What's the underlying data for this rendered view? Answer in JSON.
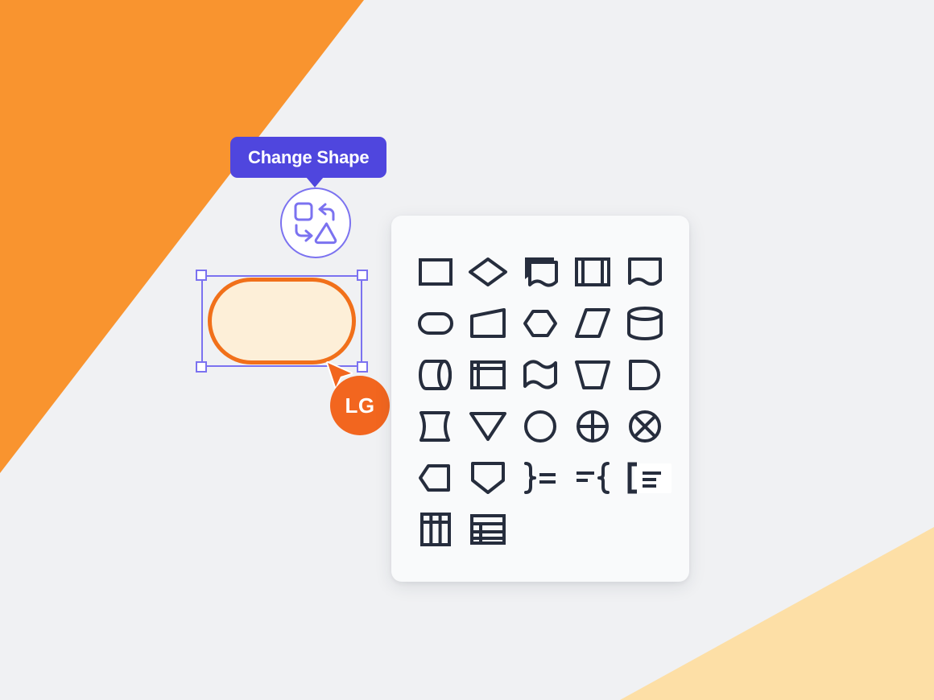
{
  "canvas": {
    "background_color": "#F0F1F3",
    "wedge_top_left_color": "#F9942F",
    "wedge_bottom_right_color": "#FDDFA6"
  },
  "tooltip": {
    "label": "Change Shape",
    "background_color": "#4F46DE",
    "text_color": "#FFFFFF"
  },
  "change_shape_button": {
    "icon": "change-shape-icon",
    "accent_color": "#7B72F0"
  },
  "selected_node": {
    "shape": "stadium",
    "fill_color": "#FDEFD8",
    "stroke_color": "#F1701A",
    "selection_color": "#7B72F0",
    "handles": [
      "top-left",
      "top-right",
      "bottom-left",
      "bottom-right"
    ]
  },
  "collaborator": {
    "initials": "LG",
    "cursor_color": "#F2661F",
    "badge_color": "#F2661F",
    "initials_color": "#FFFFFF"
  },
  "palette": {
    "background_color": "#F9FAFB",
    "icon_color": "#262D3D",
    "hovered_index": 24,
    "columns": 5,
    "shapes": [
      {
        "name": "rectangle",
        "icon": "rectangle-shape-icon"
      },
      {
        "name": "diamond",
        "icon": "diamond-shape-icon"
      },
      {
        "name": "note",
        "icon": "note-shape-icon"
      },
      {
        "name": "process",
        "icon": "process-shape-icon"
      },
      {
        "name": "document",
        "icon": "document-shape-icon"
      },
      {
        "name": "stadium",
        "icon": "stadium-shape-icon"
      },
      {
        "name": "trapezoid",
        "icon": "trapezoid-shape-icon"
      },
      {
        "name": "hexagon",
        "icon": "hexagon-shape-icon"
      },
      {
        "name": "parallelogram",
        "icon": "parallelogram-shape-icon"
      },
      {
        "name": "cylinder",
        "icon": "cylinder-shape-icon"
      },
      {
        "name": "horizontal-cylinder",
        "icon": "horizontal-cylinder-shape-icon"
      },
      {
        "name": "internal-storage",
        "icon": "internal-storage-shape-icon"
      },
      {
        "name": "wave",
        "icon": "wave-shape-icon"
      },
      {
        "name": "inverted-trapezoid",
        "icon": "inverted-trapezoid-shape-icon"
      },
      {
        "name": "delay",
        "icon": "delay-shape-icon"
      },
      {
        "name": "curved-rectangle",
        "icon": "curved-rectangle-shape-icon"
      },
      {
        "name": "triangle-down",
        "icon": "triangle-down-shape-icon"
      },
      {
        "name": "circle",
        "icon": "circle-shape-icon"
      },
      {
        "name": "circle-cross",
        "icon": "circle-cross-shape-icon"
      },
      {
        "name": "circle-x",
        "icon": "circle-x-shape-icon"
      },
      {
        "name": "left-hexagon",
        "icon": "left-hexagon-shape-icon"
      },
      {
        "name": "shield",
        "icon": "shield-shape-icon"
      },
      {
        "name": "brace-right-annotation",
        "icon": "brace-right-annotation-icon"
      },
      {
        "name": "brace-left-annotation",
        "icon": "brace-left-annotation-icon"
      },
      {
        "name": "bracket-annotation",
        "icon": "bracket-annotation-icon"
      },
      {
        "name": "table-columns",
        "icon": "table-columns-shape-icon"
      },
      {
        "name": "table-rows",
        "icon": "table-rows-shape-icon"
      }
    ]
  }
}
